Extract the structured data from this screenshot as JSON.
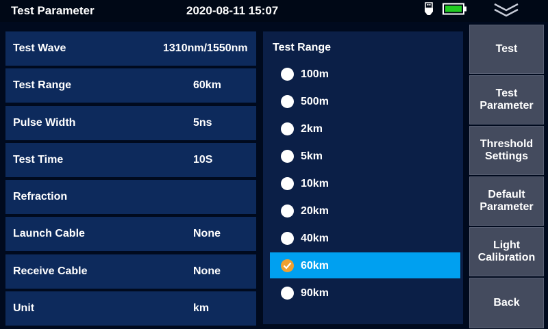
{
  "header": {
    "title": "Test Parameter",
    "datetime": "2020-08-11 15:07"
  },
  "params": [
    {
      "label": "Test Wave",
      "value": "1310nm/1550nm"
    },
    {
      "label": "Test Range",
      "value": "60km"
    },
    {
      "label": "Pulse Width",
      "value": "5ns"
    },
    {
      "label": "Test Time",
      "value": "10S"
    },
    {
      "label": "Refraction",
      "value": ""
    },
    {
      "label": "Launch Cable",
      "value": "None"
    },
    {
      "label": "Receive Cable",
      "value": "None"
    },
    {
      "label": "Unit",
      "value": "km"
    }
  ],
  "range_panel": {
    "title": "Test Range",
    "options": [
      "100m",
      "500m",
      "2km",
      "5km",
      "10km",
      "20km",
      "40km",
      "60km",
      "90km"
    ],
    "selected": "60km"
  },
  "side_buttons": [
    "Test",
    "Test\nParameter",
    "Threshold\nSettings",
    "Default\nParameter",
    "Light\nCalibration",
    "Back"
  ],
  "colors": {
    "selection": "#00a0f0",
    "check": "#f0a030",
    "battery": "#22cc22"
  },
  "icons": [
    "usb-icon",
    "battery-icon",
    "collapse-chevron-icon",
    "checkmark-icon"
  ]
}
